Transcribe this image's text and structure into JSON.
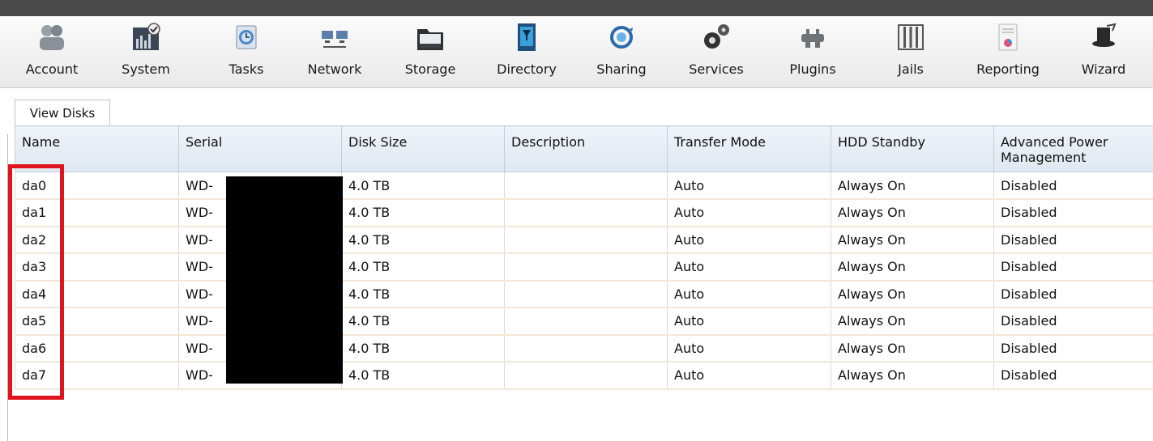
{
  "toolbar": {
    "items": [
      {
        "label": "Account",
        "icon": "account-icon"
      },
      {
        "label": "System",
        "icon": "system-icon"
      },
      {
        "label": "Tasks",
        "icon": "tasks-icon"
      },
      {
        "label": "Network",
        "icon": "network-icon"
      },
      {
        "label": "Storage",
        "icon": "storage-icon"
      },
      {
        "label": "Directory",
        "icon": "directory-icon"
      },
      {
        "label": "Sharing",
        "icon": "sharing-icon"
      },
      {
        "label": "Services",
        "icon": "services-icon"
      },
      {
        "label": "Plugins",
        "icon": "plugins-icon"
      },
      {
        "label": "Jails",
        "icon": "jails-icon"
      },
      {
        "label": "Reporting",
        "icon": "reporting-icon"
      },
      {
        "label": "Wizard",
        "icon": "wizard-icon"
      }
    ]
  },
  "tabs": [
    {
      "label": "View Disks"
    }
  ],
  "table": {
    "columns": [
      "Name",
      "Serial",
      "Disk Size",
      "Description",
      "Transfer Mode",
      "HDD Standby",
      "Advanced Power Management"
    ],
    "rows": [
      {
        "name": "da0",
        "serial": "WD-",
        "size": "4.0 TB",
        "description": "",
        "transfer": "Auto",
        "standby": "Always On",
        "apm": "Disabled"
      },
      {
        "name": "da1",
        "serial": "WD-",
        "size": "4.0 TB",
        "description": "",
        "transfer": "Auto",
        "standby": "Always On",
        "apm": "Disabled"
      },
      {
        "name": "da2",
        "serial": "WD-",
        "size": "4.0 TB",
        "description": "",
        "transfer": "Auto",
        "standby": "Always On",
        "apm": "Disabled"
      },
      {
        "name": "da3",
        "serial": "WD-",
        "size": "4.0 TB",
        "description": "",
        "transfer": "Auto",
        "standby": "Always On",
        "apm": "Disabled"
      },
      {
        "name": "da4",
        "serial": "WD-",
        "size": "4.0 TB",
        "description": "",
        "transfer": "Auto",
        "standby": "Always On",
        "apm": "Disabled"
      },
      {
        "name": "da5",
        "serial": "WD-",
        "size": "4.0 TB",
        "description": "",
        "transfer": "Auto",
        "standby": "Always On",
        "apm": "Disabled"
      },
      {
        "name": "da6",
        "serial": "WD-",
        "size": "4.0 TB",
        "description": "",
        "transfer": "Auto",
        "standby": "Always On",
        "apm": "Disabled"
      },
      {
        "name": "da7",
        "serial": "WD-",
        "size": "4.0 TB",
        "description": "",
        "transfer": "Auto",
        "standby": "Always On",
        "apm": "Disabled"
      }
    ]
  },
  "colors": {
    "highlight": "#e0141e",
    "redaction": "#000000"
  }
}
